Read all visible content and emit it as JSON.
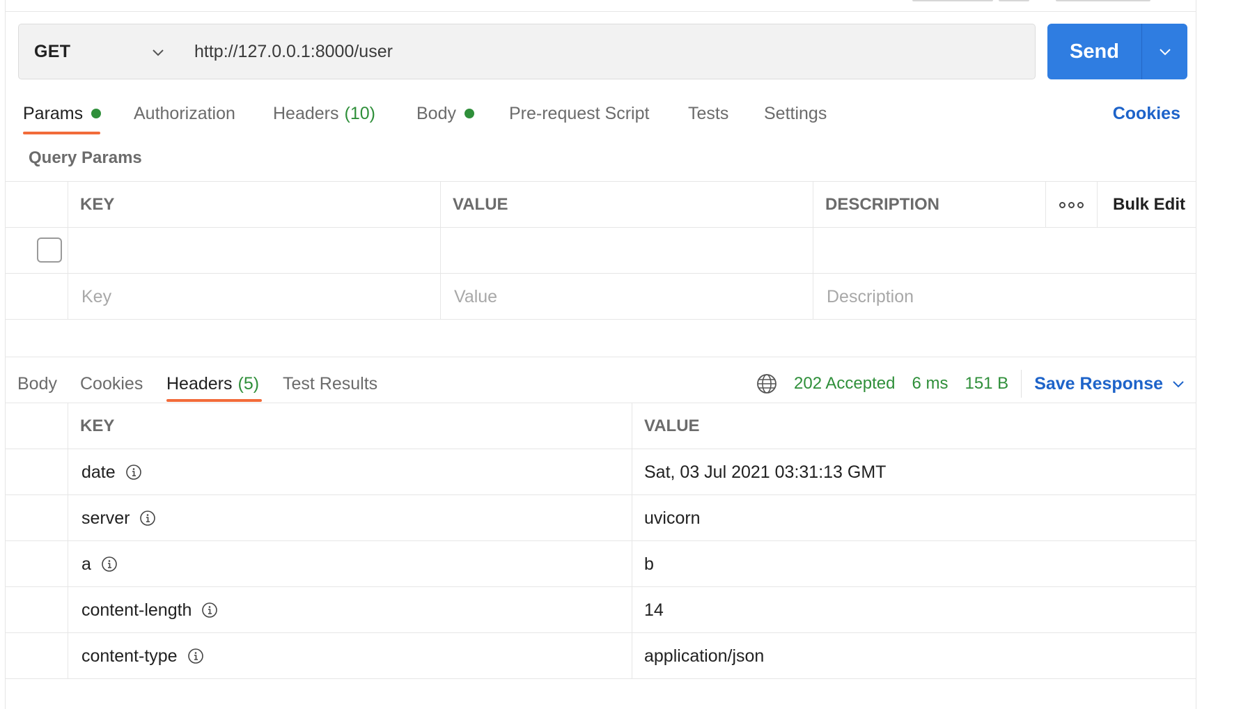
{
  "request": {
    "method": "GET",
    "url": "http://127.0.0.1:8000/user",
    "send_label": "Send"
  },
  "request_tabs": {
    "params": "Params",
    "authorization": "Authorization",
    "headers": "Headers",
    "headers_count": "(10)",
    "body": "Body",
    "pre_request": "Pre-request Script",
    "tests": "Tests",
    "settings": "Settings",
    "cookies": "Cookies"
  },
  "query_params": {
    "title": "Query Params",
    "columns": {
      "key": "KEY",
      "value": "VALUE",
      "description": "DESCRIPTION",
      "bulk_edit": "Bulk Edit"
    },
    "placeholders": {
      "key": "Key",
      "value": "Value",
      "description": "Description"
    }
  },
  "response_tabs": {
    "body": "Body",
    "cookies": "Cookies",
    "headers": "Headers",
    "headers_count": "(5)",
    "test_results": "Test Results"
  },
  "response_status": {
    "status": "202 Accepted",
    "time": "6 ms",
    "size": "151 B",
    "save_label": "Save Response"
  },
  "response_headers": {
    "columns": {
      "key": "KEY",
      "value": "VALUE"
    },
    "rows": [
      {
        "key": "date",
        "value": "Sat, 03 Jul 2021 03:31:13 GMT"
      },
      {
        "key": "server",
        "value": "uvicorn"
      },
      {
        "key": "a",
        "value": "b"
      },
      {
        "key": "content-length",
        "value": "14"
      },
      {
        "key": "content-type",
        "value": "application/json"
      }
    ]
  },
  "colors": {
    "accent_blue": "#2f7de1",
    "link_blue": "#1d63c9",
    "status_green": "#2f8f3a",
    "tab_underline": "#f26b3a"
  }
}
